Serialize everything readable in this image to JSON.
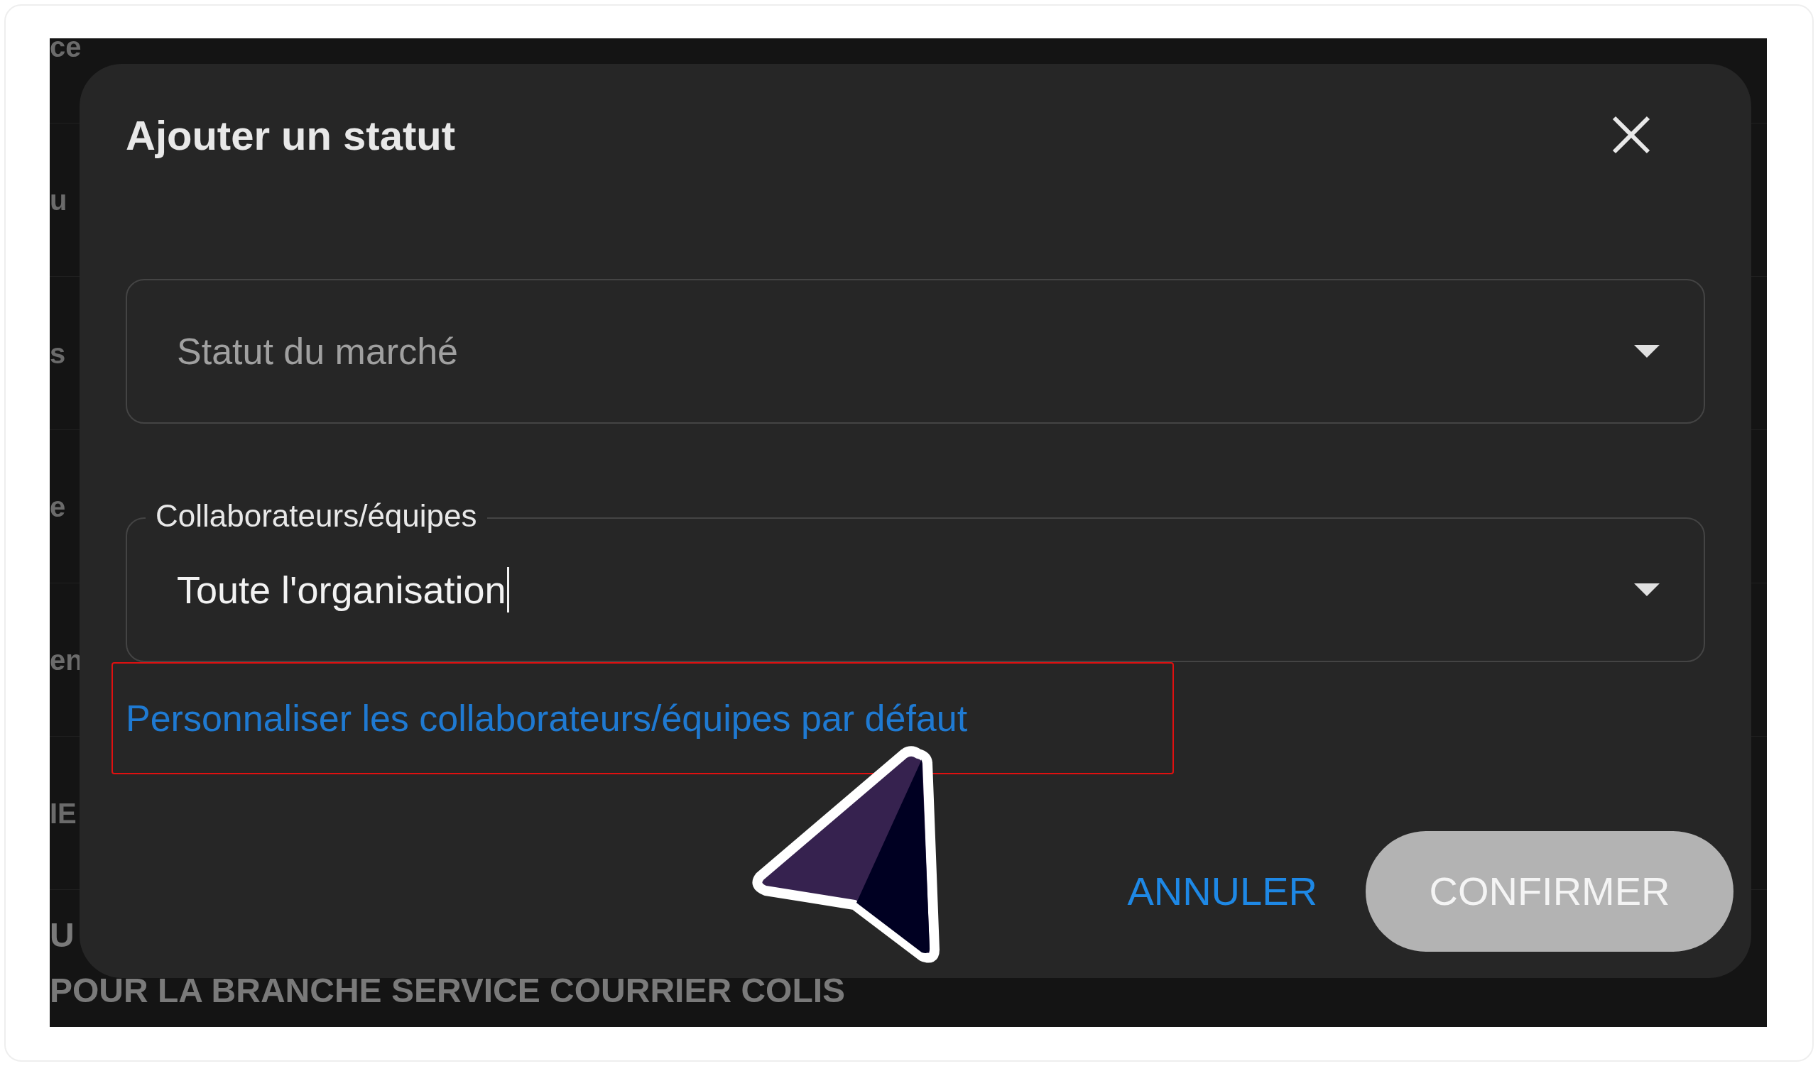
{
  "background_rows": [
    {
      "text": "ce"
    },
    {
      "text": "u"
    },
    {
      "text": "s"
    },
    {
      "text": "e"
    },
    {
      "text": "en"
    },
    {
      "text": "IE"
    },
    {
      "text": "U"
    },
    {
      "text": "POUR LA BRANCHE SERVICE COURRIER COLIS"
    }
  ],
  "dialog": {
    "title": "Ajouter un statut",
    "fields": [
      {
        "kind": "select",
        "placeholder": "Statut du marché",
        "focused": false
      },
      {
        "kind": "select",
        "label": "Collaborateurs/équipes",
        "value": "Toute l'organisation",
        "focused": true
      }
    ],
    "link": {
      "text": "Personnaliser les collaborateurs/équipes par défaut",
      "highlighted": true
    },
    "buttons": [
      {
        "label": "ANNULER",
        "kind": "text"
      },
      {
        "label": "CONFIRMER",
        "kind": "filled"
      }
    ]
  }
}
